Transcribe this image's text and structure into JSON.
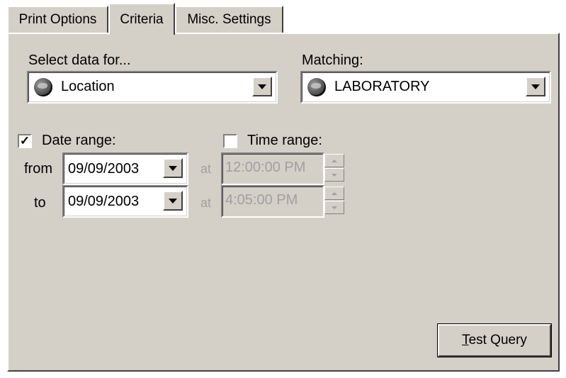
{
  "tabs": [
    {
      "label": "Print Options"
    },
    {
      "label": "Criteria",
      "selected": true
    },
    {
      "label": "Misc. Settings"
    }
  ],
  "select_data": {
    "label": "Select data for...",
    "value": "Location",
    "icon": "globe-icon"
  },
  "matching": {
    "label": "Matching:",
    "value": "LABORATORY",
    "icon": "globe-icon"
  },
  "date_range": {
    "label": "Date range:",
    "checked": true,
    "from_label": "from",
    "to_label": "to",
    "from_value": "09/09/2003",
    "to_value": "09/09/2003"
  },
  "time_range": {
    "label": "Time range:",
    "checked": false,
    "at_label": "at",
    "from_value": "12:00:00 PM",
    "to_value": "4:05:00 PM"
  },
  "test_query": {
    "mnemonic": "T",
    "rest": "est Query"
  },
  "colors": {
    "face": "#d4d0c8",
    "disabled_text": "#a0a0a0"
  }
}
